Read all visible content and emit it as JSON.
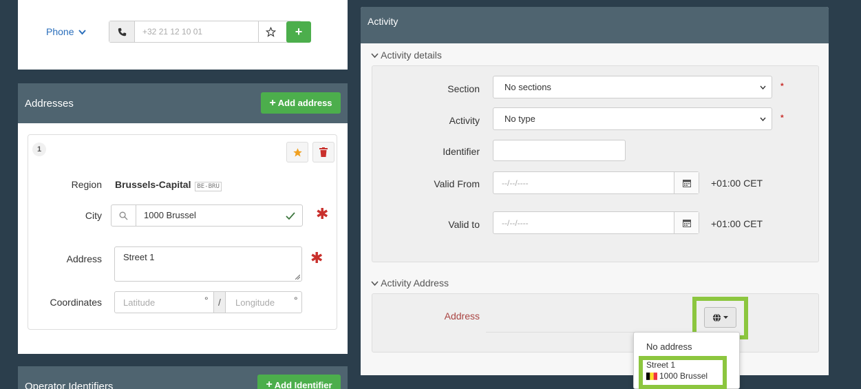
{
  "left": {
    "phone": {
      "label": "Phone",
      "placeholder": "+32 21 12 10 01"
    },
    "addresses": {
      "title": "Addresses",
      "add_label": "Add address",
      "card_index": "1",
      "region_label": "Region",
      "region_value": "Brussels-Capital",
      "region_code": "BE-BRU",
      "city_label": "City",
      "city_value": "1000 Brussel",
      "address_label": "Address",
      "address_value": "Street 1",
      "coords_label": "Coordinates",
      "lat_placeholder": "Latitude",
      "lon_placeholder": "Longitude",
      "degree": "°",
      "slash": "/"
    },
    "operator": {
      "title": "Operator Identifiers",
      "add_label": "Add Identifier"
    }
  },
  "right": {
    "title": "Activity",
    "details": {
      "heading": "Activity details",
      "section_label": "Section",
      "section_value": "No sections",
      "activity_label": "Activity",
      "activity_value": "No type",
      "identifier_label": "Identifier",
      "valid_from_label": "Valid From",
      "valid_to_label": "Valid to",
      "date_placeholder": "--/--/----",
      "tz": "+01:00 CET",
      "required_mark": "*"
    },
    "address": {
      "heading": "Activity Address",
      "label": "Address",
      "dropdown": {
        "no_address": "No address",
        "option_street": "Street 1",
        "option_city": "1000 Brussel"
      }
    }
  },
  "colors": {
    "accent_green": "#4cae4c",
    "highlight": "#8cc63f",
    "header": "#4f6470",
    "required": "#c9302c"
  },
  "icons": [
    "phone-icon",
    "star-icon",
    "plus-icon",
    "trash-icon",
    "search-icon",
    "check-icon",
    "calendar-icon",
    "globe-icon",
    "caret-down-icon",
    "chevron-down-icon",
    "belgium-flag-icon"
  ]
}
